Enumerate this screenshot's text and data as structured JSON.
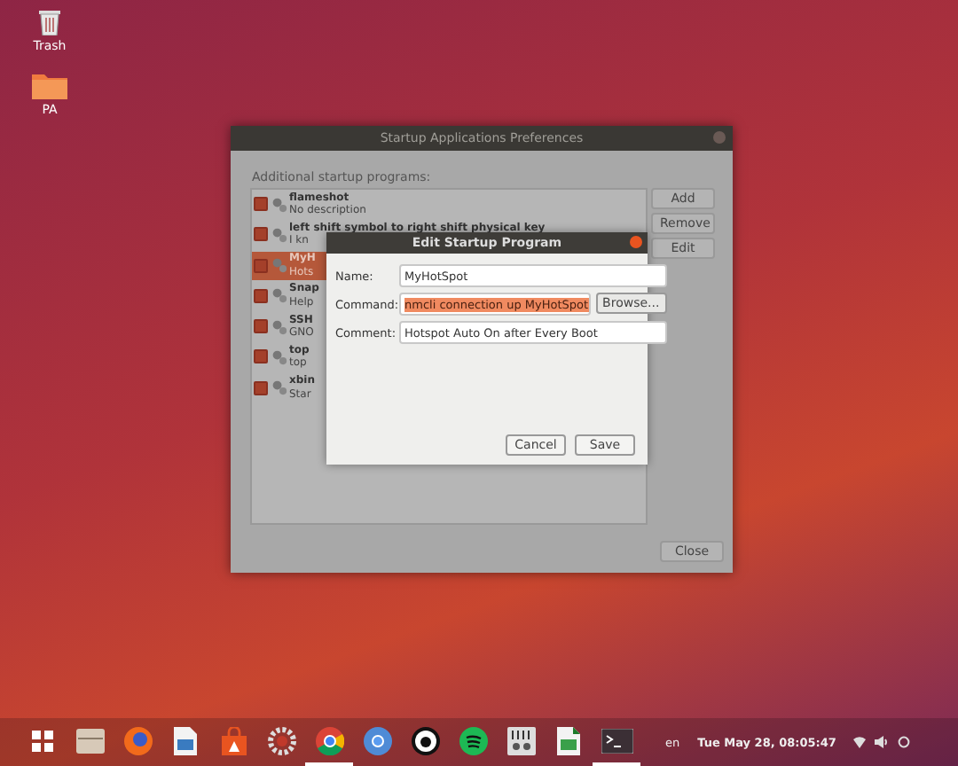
{
  "desktop_icons": [
    {
      "label": "Trash",
      "kind": "trash"
    },
    {
      "label": "PA",
      "kind": "folder"
    }
  ],
  "back_window": {
    "title": "Startup Applications Preferences",
    "section_label": "Additional startup programs:",
    "programs": [
      {
        "name": "flameshot",
        "description": "No description",
        "checked": true,
        "selected": false
      },
      {
        "name": "left shift symbol to right shift physical key",
        "description": "I kn",
        "checked": true,
        "selected": false
      },
      {
        "name": "MyH",
        "description": "Hots",
        "checked": true,
        "selected": true
      },
      {
        "name": "Snap",
        "description": "Help",
        "checked": true,
        "selected": false
      },
      {
        "name": "SSH",
        "description": "GNO",
        "checked": true,
        "selected": false
      },
      {
        "name": "top",
        "description": "top",
        "checked": true,
        "selected": false
      },
      {
        "name": "xbin",
        "description": "Star",
        "checked": true,
        "selected": false
      }
    ],
    "buttons": [
      "Add",
      "Remove",
      "Edit"
    ],
    "close_button": "Close"
  },
  "dialog": {
    "title": "Edit Startup Program",
    "fields": [
      {
        "label": "Name:",
        "value": "MyHotSpot",
        "text_selected": false
      },
      {
        "label": "Command:",
        "value": "nmcli connection up MyHotSpot",
        "text_selected": true
      },
      {
        "label": "Comment:",
        "value": "Hotspot Auto On after Every Boot",
        "text_selected": false
      }
    ],
    "browse_button": "Browse...",
    "buttons": [
      "Cancel",
      "Save"
    ]
  },
  "taskbar": {
    "apps": [
      {
        "kind": "grid",
        "active": false
      },
      {
        "kind": "files",
        "active": false
      },
      {
        "kind": "firefox",
        "active": false
      },
      {
        "kind": "writer",
        "active": false
      },
      {
        "kind": "store",
        "active": false
      },
      {
        "kind": "gear",
        "active": false
      },
      {
        "kind": "chrome",
        "active": true
      },
      {
        "kind": "chromium",
        "active": false
      },
      {
        "kind": "circle-a",
        "active": false
      },
      {
        "kind": "spotify",
        "active": false
      },
      {
        "kind": "mixer",
        "active": false
      },
      {
        "kind": "calc",
        "active": false
      },
      {
        "kind": "terminal",
        "active": true
      }
    ],
    "language": "en",
    "clock": "Tue May 28, 08:05:47"
  }
}
